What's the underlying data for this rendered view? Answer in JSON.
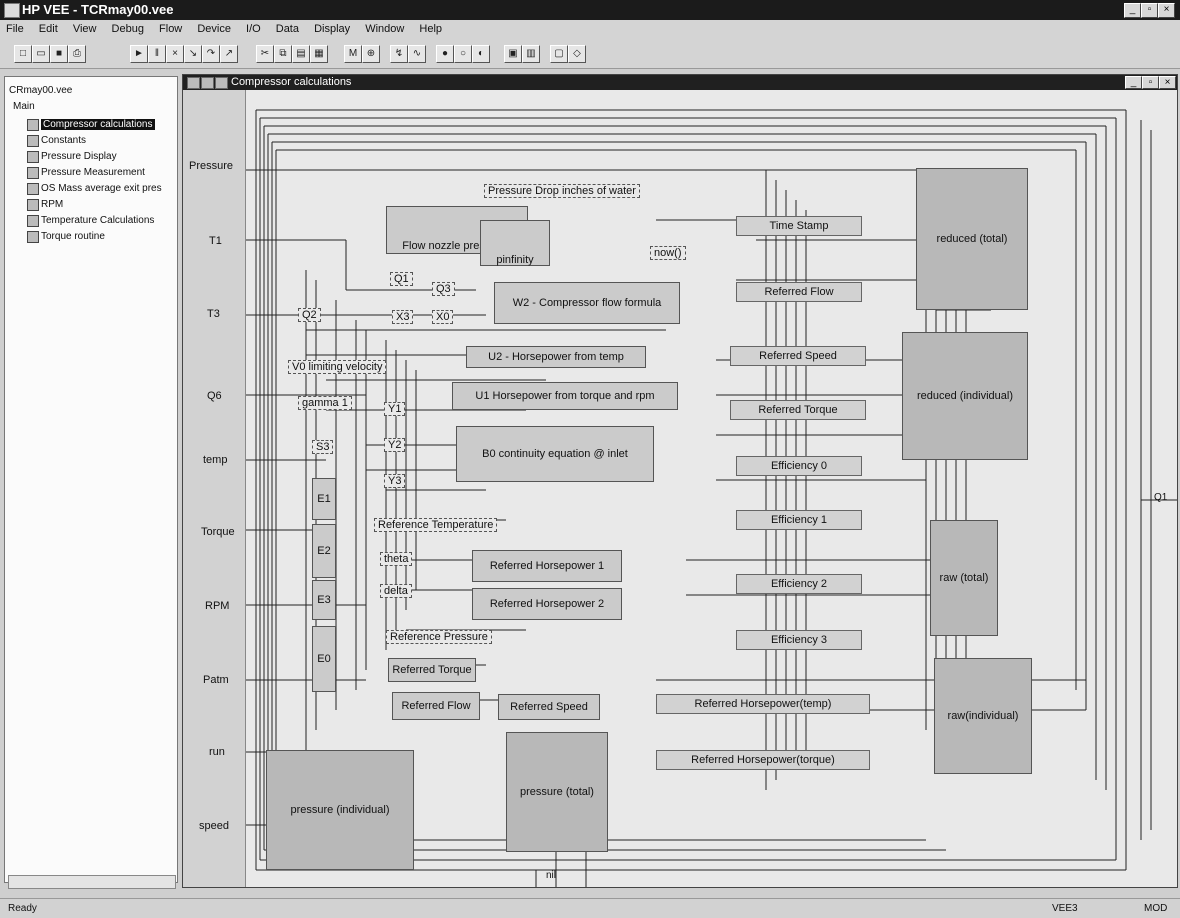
{
  "window": {
    "title": "HP VEE - TCRmay00.vee"
  },
  "menu": [
    "File",
    "Edit",
    "View",
    "Debug",
    "Flow",
    "Device",
    "I/O",
    "Data",
    "Display",
    "Window",
    "Help"
  ],
  "tree": {
    "root": "CRmay00.vee",
    "main": "Main",
    "items": [
      "Compressor calculations",
      "Constants",
      "Pressure Display",
      "Pressure Measurement",
      "OS Mass average exit pres",
      "RPM",
      "Temperature Calculations",
      "Torque routine"
    ]
  },
  "inner_window": {
    "title": "Compressor calculations"
  },
  "inputs": [
    "Pressure",
    "T1",
    "T3",
    "Q6",
    "temp",
    "Torque",
    "RPM",
    "Patm",
    "run",
    "speed"
  ],
  "formula_boxes": {
    "flow_nozzle": "Flow nozzle pressures",
    "pinfinity": "pinfinity",
    "pressure_drop": "Pressure Drop inches of water",
    "now": "now()",
    "w2": "W2 - Compressor flow formula",
    "u2": "U2 - Horsepower from temp",
    "u1": "U1 Horsepower from torque and rpm",
    "b0": "B0 continuity equation @ inlet",
    "v0": "V0 limiting velocity",
    "gamma": "gamma 1",
    "ref_temp": "Reference Temperature",
    "theta": "theta",
    "delta": "delta",
    "ref_hp1": "Referred Horsepower 1",
    "ref_hp2": "Referred Horsepower 2",
    "ref_pressure": "Reference Pressure",
    "ref_torque": "Referred Torque",
    "ref_flow": "Referred Flow",
    "ref_speed": "Referred Speed"
  },
  "small_vars": [
    "Q1",
    "Q2",
    "Q3",
    "X0",
    "X3",
    "Y1",
    "Y2",
    "Y3",
    "S3",
    "E1",
    "E2",
    "E3",
    "E0"
  ],
  "display_labels": [
    "Time Stamp",
    "Referred Flow",
    "Referred Speed",
    "Referred Torque",
    "Efficiency 0",
    "Efficiency 1",
    "Efficiency 2",
    "Efficiency 3",
    "Referred Horsepower(temp)",
    "Referred Horsepower(torque)"
  ],
  "displays": {
    "reduced_total": "reduced (total)",
    "reduced_individual": "reduced (individual)",
    "raw_total": "raw (total)",
    "raw_individual": "raw(individual)",
    "pressure_individual": "pressure (individual)",
    "pressure_total": "pressure (total)"
  },
  "output_terminal": "Q1",
  "nil_label": "nil",
  "status": {
    "left": "Ready",
    "vee": "VEE3",
    "mod": "MOD"
  }
}
